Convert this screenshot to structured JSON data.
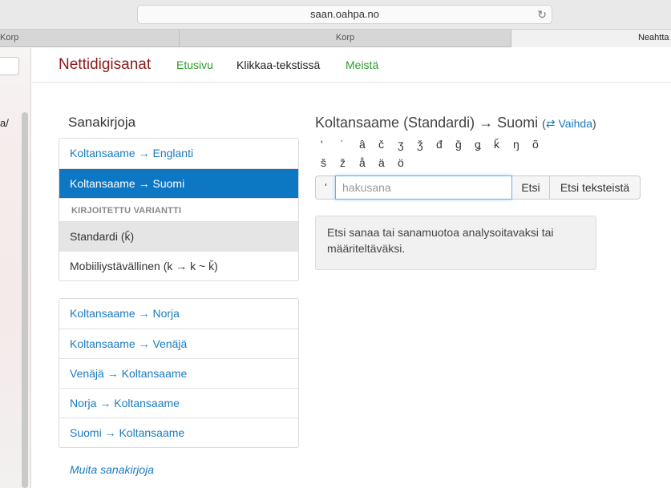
{
  "browser": {
    "url": "saan.oahpa.no",
    "tabs": [
      {
        "label": "Korp"
      },
      {
        "label": "Korp"
      },
      {
        "label": "Neahtta"
      }
    ]
  },
  "sidebar": {
    "text": "a/"
  },
  "nav": {
    "brand": "Nettidigisanat",
    "links": [
      "Etusivu",
      "Klikkaa-tekstissä",
      "Meistä"
    ]
  },
  "dictionaries": {
    "title": "Sanakirjoja",
    "main_items": [
      {
        "label": "Koltansaame → Englanti"
      },
      {
        "label": "Koltansaame → Suomi"
      }
    ],
    "variant_heading": "KIRJOITETTU VARIANTTI",
    "variants": [
      {
        "label": "Standardi (ǩ)"
      },
      {
        "label": "Mobiiliystävällinen (k → k ~ ǩ)"
      }
    ],
    "other_items": [
      {
        "label": "Koltansaame → Norja"
      },
      {
        "label": "Koltansaame → Venäjä"
      },
      {
        "label": "Venäjä → Koltansaame"
      },
      {
        "label": "Norja → Koltansaame"
      },
      {
        "label": "Suomi → Koltansaame"
      }
    ],
    "more_link": "Muita sanakirjoja"
  },
  "search": {
    "heading": "Koltansaame (Standardi) → Suomi",
    "swap_open": "(",
    "swap_icon": "⇄",
    "swap_label": "Vaihda",
    "swap_close": ")",
    "chars_row1": [
      "ʹ",
      "ˈ",
      "â",
      "č",
      "ʒ",
      "ǯ",
      "đ",
      "ǧ",
      "ǥ",
      "ǩ",
      "ŋ",
      "õ"
    ],
    "chars_row2": [
      "š",
      "ž",
      "å",
      "ä",
      "ö"
    ],
    "apostrophe_btn": "ʹ",
    "placeholder": "hakusana",
    "btn_search": "Etsi",
    "btn_search_texts": "Etsi teksteistä",
    "info": "Etsi sanaa tai sanamuotoa analysoitavaksi tai määriteltäväksi."
  }
}
